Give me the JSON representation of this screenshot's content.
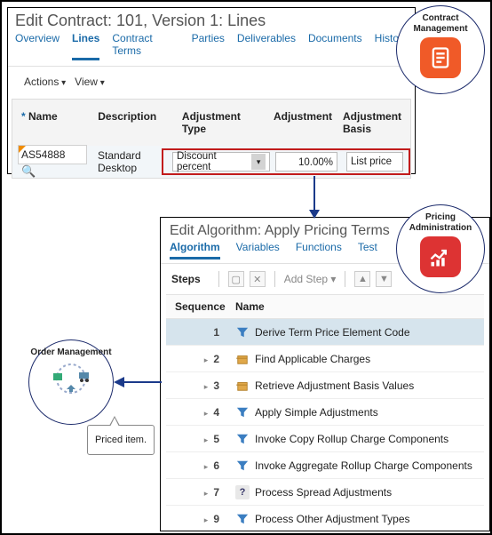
{
  "contract": {
    "title": "Edit Contract: 101, Version 1: Lines",
    "tabs": [
      "Overview",
      "Lines",
      "Contract Terms",
      "Parties",
      "Deliverables",
      "Documents",
      "History"
    ],
    "active_tab": "Lines",
    "actions": {
      "actions_label": "Actions",
      "view_label": "View"
    },
    "columns": {
      "name": "Name",
      "desc": "Description",
      "adjt": "Adjustment Type",
      "adj": "Adjustment",
      "basis": "Adjustment Basis"
    },
    "row": {
      "name": "AS54888",
      "desc": "Standard Desktop",
      "adj_type": "Discount percent",
      "adjustment": "10.00%",
      "basis": "List price"
    }
  },
  "algorithm": {
    "title": "Edit Algorithm: Apply Pricing Terms",
    "tabs": [
      "Algorithm",
      "Variables",
      "Functions",
      "Test"
    ],
    "active_tab": "Algorithm",
    "steps_label": "Steps",
    "add_step_label": "Add Step",
    "columns": {
      "seq": "Sequence",
      "name": "Name"
    },
    "rows": [
      {
        "seq": "1",
        "name": "Derive Term Price Element Code",
        "icon": "funnel",
        "selected": true,
        "expandable": false
      },
      {
        "seq": "2",
        "name": "Find Applicable Charges",
        "icon": "box",
        "selected": false,
        "expandable": true
      },
      {
        "seq": "3",
        "name": "Retrieve Adjustment Basis Values",
        "icon": "box",
        "selected": false,
        "expandable": true
      },
      {
        "seq": "4",
        "name": "Apply Simple Adjustments",
        "icon": "funnel",
        "selected": false,
        "expandable": true
      },
      {
        "seq": "5",
        "name": "Invoke Copy Rollup Charge Components",
        "icon": "funnel",
        "selected": false,
        "expandable": true
      },
      {
        "seq": "6",
        "name": "Invoke Aggregate Rollup Charge Components",
        "icon": "funnel",
        "selected": false,
        "expandable": true
      },
      {
        "seq": "7",
        "name": "Process Spread Adjustments",
        "icon": "question",
        "selected": false,
        "expandable": true
      },
      {
        "seq": "9",
        "name": "Process Other Adjustment Types",
        "icon": "funnel",
        "selected": false,
        "expandable": true
      }
    ]
  },
  "badges": {
    "contract_mgmt": "Contract Management",
    "pricing_admin": "Pricing Administration",
    "order_mgmt": "Order Management"
  },
  "callout": "Priced item."
}
